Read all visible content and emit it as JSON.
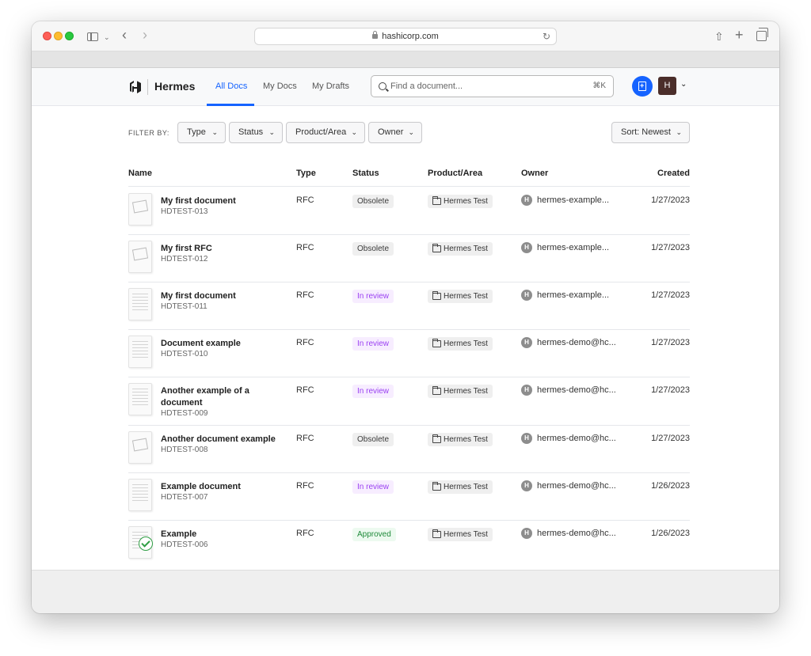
{
  "browser": {
    "url": "hashicorp.com"
  },
  "app": {
    "name": "Hermes"
  },
  "nav": {
    "tabs": [
      "All Docs",
      "My Docs",
      "My Drafts"
    ]
  },
  "search": {
    "placeholder": "Find a document...",
    "shortcut": "⌘K"
  },
  "user": {
    "initial": "H"
  },
  "filters": {
    "label": "FILTER BY:",
    "type": "Type",
    "status": "Status",
    "product": "Product/Area",
    "owner": "Owner",
    "sort": "Sort: Newest"
  },
  "table": {
    "columns": [
      "Name",
      "Type",
      "Status",
      "Product/Area",
      "Owner",
      "Created"
    ],
    "rows": [
      {
        "title": "My first document",
        "id": "HDTEST-013",
        "type": "RFC",
        "status": "Obsolete",
        "status_kind": "obsolete",
        "product": "Hermes Test",
        "owner_initial": "H",
        "owner": "hermes-example...",
        "created": "1/27/2023",
        "thumb": "draft"
      },
      {
        "title": "My first RFC",
        "id": "HDTEST-012",
        "type": "RFC",
        "status": "Obsolete",
        "status_kind": "obsolete",
        "product": "Hermes Test",
        "owner_initial": "H",
        "owner": "hermes-example...",
        "created": "1/27/2023",
        "thumb": "draft"
      },
      {
        "title": "My first document",
        "id": "HDTEST-011",
        "type": "RFC",
        "status": "In review",
        "status_kind": "review",
        "product": "Hermes Test",
        "owner_initial": "H",
        "owner": "hermes-example...",
        "created": "1/27/2023",
        "thumb": "text"
      },
      {
        "title": "Document example",
        "id": "HDTEST-010",
        "type": "RFC",
        "status": "In review",
        "status_kind": "review",
        "product": "Hermes Test",
        "owner_initial": "H",
        "owner": "hermes-demo@hc...",
        "created": "1/27/2023",
        "thumb": "text"
      },
      {
        "title": "Another example of a document",
        "id": "HDTEST-009",
        "type": "RFC",
        "status": "In review",
        "status_kind": "review",
        "product": "Hermes Test",
        "owner_initial": "H",
        "owner": "hermes-demo@hc...",
        "created": "1/27/2023",
        "thumb": "text"
      },
      {
        "title": "Another document example",
        "id": "HDTEST-008",
        "type": "RFC",
        "status": "Obsolete",
        "status_kind": "obsolete",
        "product": "Hermes Test",
        "owner_initial": "H",
        "owner": "hermes-demo@hc...",
        "created": "1/27/2023",
        "thumb": "draft"
      },
      {
        "title": "Example document",
        "id": "HDTEST-007",
        "type": "RFC",
        "status": "In review",
        "status_kind": "review",
        "product": "Hermes Test",
        "owner_initial": "H",
        "owner": "hermes-demo@hc...",
        "created": "1/26/2023",
        "thumb": "text"
      },
      {
        "title": "Example",
        "id": "HDTEST-006",
        "type": "RFC",
        "status": "Approved",
        "status_kind": "approved",
        "product": "Hermes Test",
        "owner_initial": "H",
        "owner": "hermes-demo@hc...",
        "created": "1/26/2023",
        "thumb": "approved"
      }
    ]
  },
  "colors": {
    "accent": "#1563ff",
    "review": "#9a3ff2",
    "approved": "#1f8a3a",
    "avatar": "#4b2e2a"
  }
}
